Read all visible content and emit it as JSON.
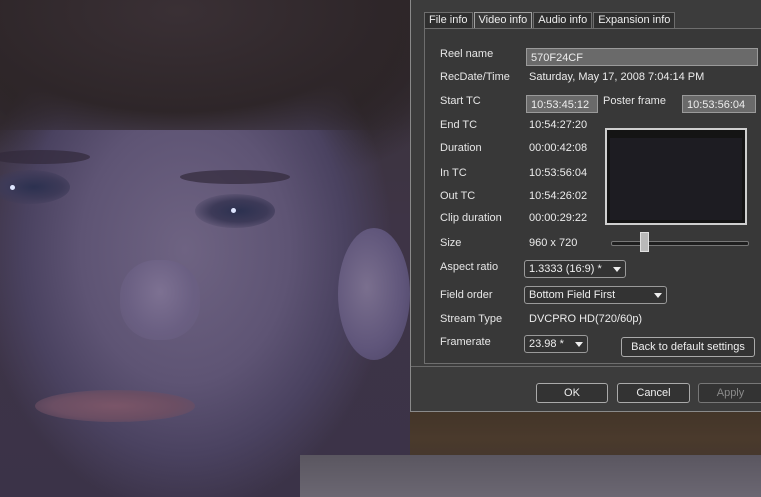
{
  "tabs": [
    "File info",
    "Video info",
    "Audio info",
    "Expansion info"
  ],
  "active_tab": "Video info",
  "fields": {
    "reel_name": {
      "label": "Reel name",
      "value": "570F24CF"
    },
    "rec_datetime": {
      "label": "RecDate/Time",
      "value": "Saturday, May 17, 2008 7:04:14 PM"
    },
    "start_tc": {
      "label": "Start TC",
      "value": "10:53:45:12"
    },
    "poster_frame": {
      "label": "Poster frame",
      "value": "10:53:56:04"
    },
    "end_tc": {
      "label": "End TC",
      "value": "10:54:27:20"
    },
    "duration": {
      "label": "Duration",
      "value": "00:00:42:08"
    },
    "in_tc": {
      "label": "In TC",
      "value": "10:53:56:04"
    },
    "out_tc": {
      "label": "Out TC",
      "value": "10:54:26:02"
    },
    "clip_duration": {
      "label": "Clip duration",
      "value": "00:00:29:22"
    },
    "size": {
      "label": "Size",
      "value": "960 x 720"
    },
    "aspect_ratio": {
      "label": "Aspect ratio",
      "value": "1.3333 (16:9) *"
    },
    "field_order": {
      "label": "Field order",
      "value": "Bottom Field First"
    },
    "stream_type": {
      "label": "Stream Type",
      "value": "DVCPRO HD(720/60p)"
    },
    "framerate": {
      "label": "Framerate",
      "value": "23.98 *"
    }
  },
  "poster_slider_level": 0.23,
  "buttons": {
    "reset": "Back to default settings",
    "ok": "OK",
    "cancel": "Cancel",
    "apply": "Apply"
  },
  "colors": {
    "dialog_bg": "#3c3c3c",
    "field_bg": "#6a6a6a"
  }
}
